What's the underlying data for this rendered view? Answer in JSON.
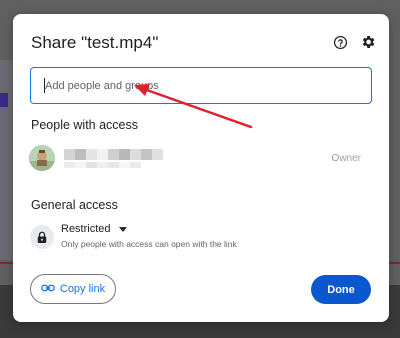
{
  "dialog": {
    "title": "Share \"test.mp4\"",
    "help_icon": "help-circle-icon",
    "settings_icon": "gear-icon"
  },
  "add_people": {
    "placeholder": "Add people and groups",
    "value": ""
  },
  "people_with_access": {
    "heading": "People with access",
    "people": [
      {
        "avatar": "avatar",
        "name_redacted": true,
        "role": "Owner"
      }
    ]
  },
  "general_access": {
    "heading": "General access",
    "icon": "lock-icon",
    "level": "Restricted",
    "dropdown_icon": "caret-down-icon",
    "description": "Only people with access can open with the link"
  },
  "footer": {
    "copy_link_label": "Copy link",
    "copy_link_icon": "link-icon",
    "done_label": "Done"
  },
  "colors": {
    "accent": "#1a73e8",
    "primary_button": "#0b57d0",
    "annotation_arrow": "#e0202a"
  }
}
